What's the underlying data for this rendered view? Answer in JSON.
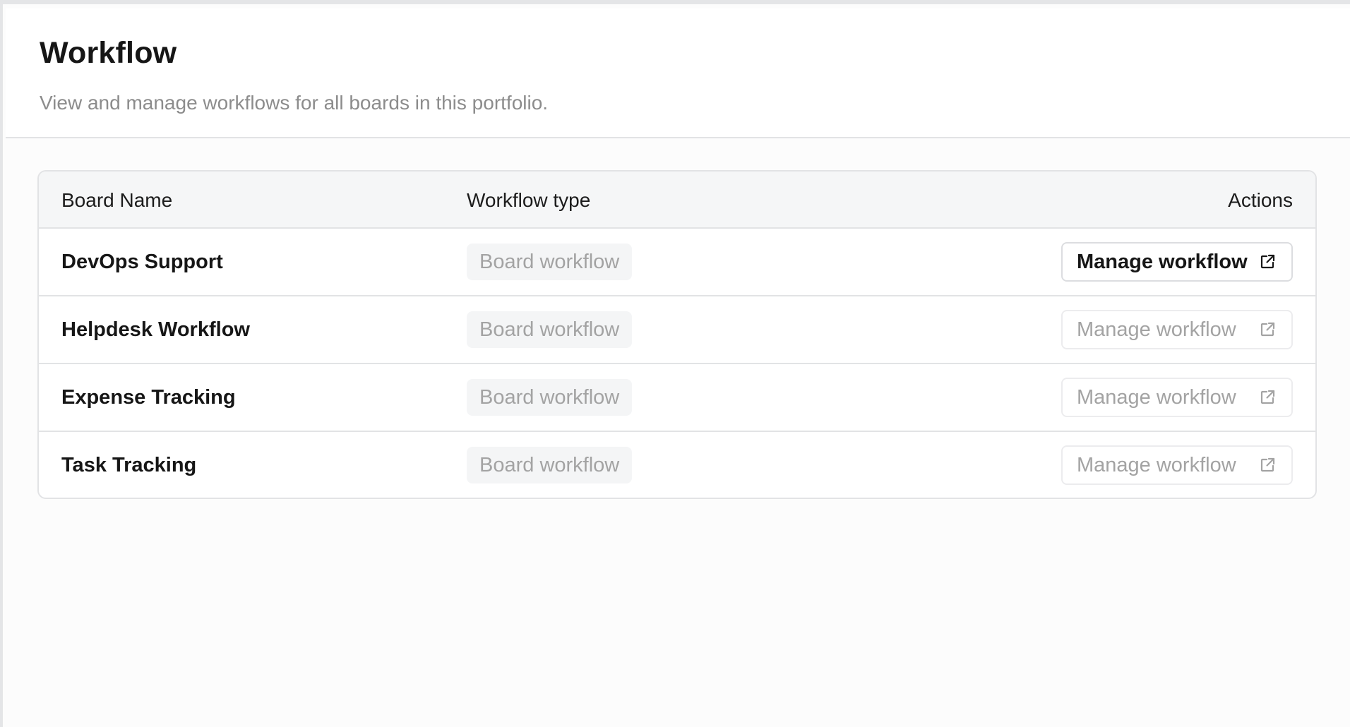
{
  "header": {
    "title": "Workflow",
    "subtitle": "View and manage workflows for all boards in this portfolio."
  },
  "table": {
    "columns": {
      "board_name": "Board Name",
      "workflow_type": "Workflow type",
      "actions": "Actions"
    },
    "rows": [
      {
        "board_name": "DevOps Support",
        "workflow_type": "Board workflow",
        "action_label": "Manage workflow",
        "action_state": "active"
      },
      {
        "board_name": "Helpdesk Workflow",
        "workflow_type": "Board workflow",
        "action_label": "Manage workflow",
        "action_state": "muted"
      },
      {
        "board_name": "Expense Tracking",
        "workflow_type": "Board workflow",
        "action_label": "Manage workflow",
        "action_state": "muted"
      },
      {
        "board_name": "Task Tracking",
        "workflow_type": "Board workflow",
        "action_label": "Manage workflow",
        "action_state": "muted"
      }
    ]
  },
  "icons": {
    "action_icon": "external-link-icon"
  },
  "colors": {
    "active_text": "#161616",
    "muted_text": "#a3a3a3",
    "border": "#e2e3e5",
    "header_bg": "#f5f6f7"
  }
}
